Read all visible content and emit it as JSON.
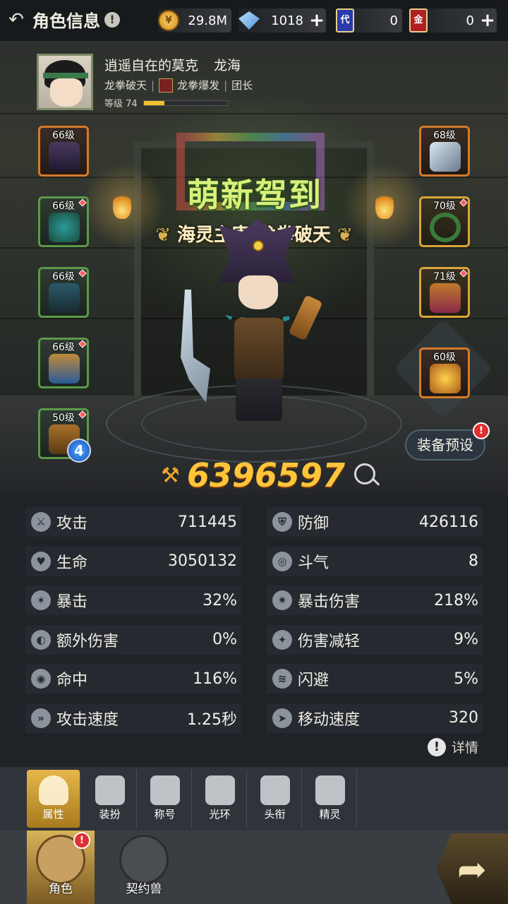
{
  "header": {
    "title": "角色信息",
    "gold": "29.8M",
    "diamonds": "1018",
    "card1_label": "代",
    "card1": "0",
    "card2_label": "金",
    "card2": "0"
  },
  "profile": {
    "name": "逍遥自在的莫克",
    "guild": "龙海",
    "class": "龙拳破天",
    "skill": "龙拳爆发",
    "role": "团长",
    "level_label": "等级 74",
    "level_progress": 0.25
  },
  "equipment_left": [
    {
      "level": "66级",
      "color": "orange"
    },
    {
      "level": "66级",
      "color": "green"
    },
    {
      "level": "66级",
      "color": "green"
    },
    {
      "level": "66级",
      "color": "green"
    },
    {
      "level": "50级",
      "color": "green",
      "badge": "4"
    }
  ],
  "equipment_right": [
    {
      "level": "68级",
      "color": "orange"
    },
    {
      "level": "70级",
      "color": "gold"
    },
    {
      "level": "71级",
      "color": "gold"
    },
    {
      "level": "60级",
      "color": "orange"
    }
  ],
  "title_banner": "萌新驾到",
  "character_title": "海灵主宰·龙拳破天",
  "preset_button": "装备预设",
  "power": "6396597",
  "stats": [
    {
      "icon": "attack-icon",
      "label": "攻击",
      "value": "711445"
    },
    {
      "icon": "defense-icon",
      "label": "防御",
      "value": "426116"
    },
    {
      "icon": "hp-icon",
      "label": "生命",
      "value": "3050132"
    },
    {
      "icon": "spirit-icon",
      "label": "斗气",
      "value": "8"
    },
    {
      "icon": "crit-icon",
      "label": "暴击",
      "value": "32%"
    },
    {
      "icon": "crit-damage-icon",
      "label": "暴击伤害",
      "value": "218%"
    },
    {
      "icon": "extra-damage-icon",
      "label": "额外伤害",
      "value": "0%"
    },
    {
      "icon": "damage-reduction-icon",
      "label": "伤害减轻",
      "value": "9%"
    },
    {
      "icon": "accuracy-icon",
      "label": "命中",
      "value": "116%"
    },
    {
      "icon": "dodge-icon",
      "label": "闪避",
      "value": "5%"
    },
    {
      "icon": "attack-speed-icon",
      "label": "攻击速度",
      "value": "1.25秒"
    },
    {
      "icon": "move-speed-icon",
      "label": "移动速度",
      "value": "320"
    }
  ],
  "detail_label": "详情",
  "tabs": [
    "属性",
    "装扮",
    "称号",
    "光环",
    "头衔",
    "精灵"
  ],
  "bottom_tabs": [
    "角色",
    "契约兽"
  ],
  "colors": {
    "accent": "#ffc53a",
    "tab_active": "#e5b74a",
    "green_border": "#5b9a48",
    "orange_border": "#d57a2a"
  }
}
